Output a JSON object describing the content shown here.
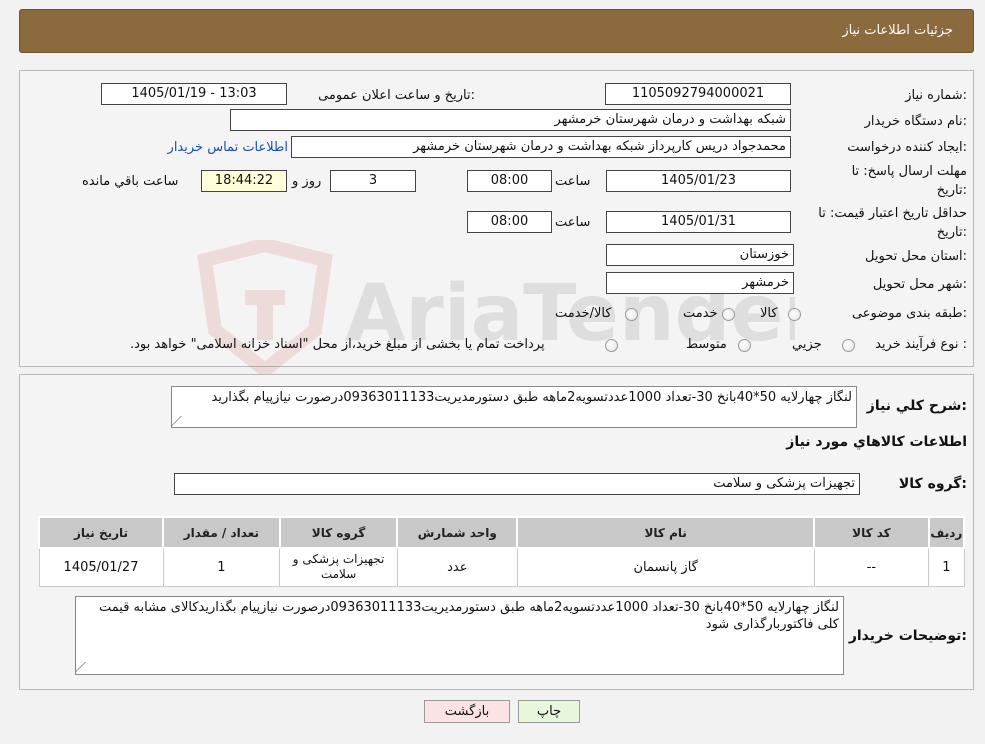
{
  "header": {
    "title": "جزئیات اطلاعات نیاز"
  },
  "form": {
    "need_number_label": "شماره نیاز:",
    "need_number": "1105092794000021",
    "announce_label": "تاریخ و ساعت اعلان عمومی:",
    "announce_value": "1405/01/19 - 13:03",
    "buyer_org_label": "نام دستگاه خریدار:",
    "buyer_org": "شبکه بهداشت و درمان شهرستان خرمشهر",
    "creator_label": "ایجاد کننده درخواست:",
    "creator": "محمدجواد دریس کارپرداز شبکه بهداشت و درمان شهرستان خرمشهر",
    "contact_link": "اطلاعات تماس خریدار",
    "deadline_label_1": "مهلت ارسال پاسخ: تا",
    "deadline_label_2": "تاریخ:",
    "deadline_date": "1405/01/23",
    "time_label": "ساعت",
    "deadline_time": "08:00",
    "days_value": "3",
    "days_label": "روز و",
    "remaining_time": "18:44:22",
    "remaining_label": "ساعت باقي مانده",
    "validity_label_1": "حداقل تاریخ اعتبار قیمت: تا",
    "validity_label_2": "تاریخ:",
    "validity_date": "1405/01/31",
    "validity_time": "08:00",
    "province_label": "استان محل تحویل:",
    "province": "خوزستان",
    "city_label": "شهر محل تحویل:",
    "city": "خرمشهر",
    "category_label": "طبقه بندی موضوعی:",
    "category_options": [
      "کالا",
      "خدمت",
      "کالا/خدمت"
    ],
    "process_label": "نوع فرآیند خرید :",
    "process_options": [
      "جزیي",
      "متوسط"
    ],
    "process_note": "پرداخت تمام یا بخشی از مبلغ خرید،از محل \"اسناد خزانه اسلامی\" خواهد بود."
  },
  "description": {
    "label": "شرح کلي نياز:",
    "text": "لنگاز چهارلایه 50*40بانخ 30-تعداد 1000عددتسویه2ماهه طبق دستورمدیریت09363011133درصورت نیازپیام بگذارید",
    "goods_info_title": "اطلاعات کالاهاي مورد نياز",
    "goods_group_label": "گروه کالا:",
    "goods_group": "تجهیزات پزشکی و سلامت"
  },
  "table": {
    "headers": [
      "رديف",
      "کد کالا",
      "نام کالا",
      "واحد شمارش",
      "گروه کالا",
      "تعداد / مقدار",
      "تاریخ نیاز"
    ],
    "rows": [
      [
        "1",
        "--",
        "گاز پانسمان",
        "عدد",
        "تجهیزات پزشکی و سلامت",
        "1",
        "1405/01/27"
      ]
    ]
  },
  "buyer_notes": {
    "label": "توضیحات خریدار:",
    "text": "لنگاز چهارلایه 50*40بانخ 30-تعداد 1000عددتسویه2ماهه طبق دستورمدیریت09363011133درصورت نیازپیام بگذاریدکالای مشابه قیمت کلی فاکتوربارگذاری شود"
  },
  "buttons": {
    "print": "چاپ",
    "back": "بازگشت"
  },
  "watermark": {
    "brand": "AriaTender.neT"
  },
  "colors": {
    "header_bg": "#8b6a3e",
    "link": "#1a4fb0",
    "back_button": "#fbe3e3",
    "print_button": "#e6f7dc",
    "highlight": "#ffffd9"
  }
}
